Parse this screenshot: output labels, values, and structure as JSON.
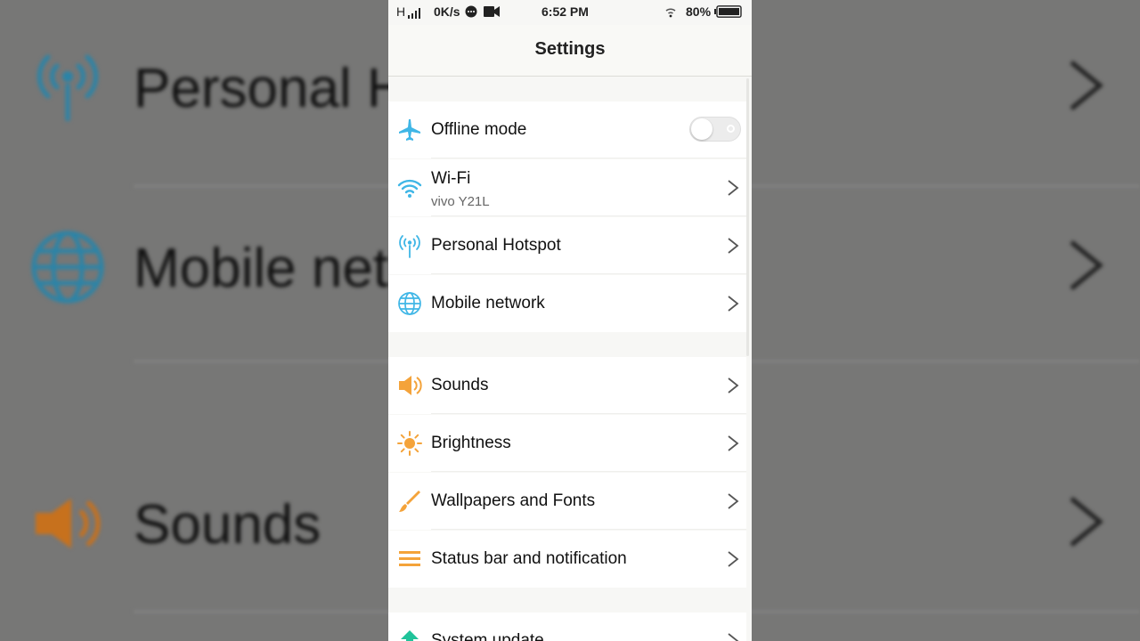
{
  "status_bar": {
    "signal": "H",
    "net_speed": "0K/s",
    "time": "6:52 PM",
    "battery": "80%"
  },
  "header": {
    "title": "Settings"
  },
  "background_zoom": {
    "items": [
      {
        "label": "Personal H",
        "icon": "hotspot-icon"
      },
      {
        "label": "Mobile net",
        "icon": "globe-icon"
      },
      {
        "label": "Sounds",
        "icon": "speaker-icon"
      }
    ]
  },
  "settings": {
    "group1": [
      {
        "label": "Offline mode",
        "icon": "airplane-icon",
        "control": "toggle",
        "toggle_on": false
      },
      {
        "label": "Wi-Fi",
        "sublabel": "vivo Y21L",
        "icon": "wifi-icon",
        "control": "chevron"
      },
      {
        "label": "Personal Hotspot",
        "icon": "hotspot-icon",
        "control": "chevron"
      },
      {
        "label": "Mobile network",
        "icon": "globe-icon",
        "control": "chevron"
      }
    ],
    "group2": [
      {
        "label": "Sounds",
        "icon": "speaker-icon",
        "control": "chevron"
      },
      {
        "label": "Brightness",
        "icon": "sun-icon",
        "control": "chevron"
      },
      {
        "label": "Wallpapers and Fonts",
        "icon": "brush-icon",
        "control": "chevron"
      },
      {
        "label": "Status bar and notification",
        "icon": "lines-icon",
        "control": "chevron"
      }
    ],
    "group3": [
      {
        "label": "System update",
        "icon": "arrow-up-icon",
        "control": "chevron"
      }
    ]
  },
  "colors": {
    "network_icon": "#3fb6e6",
    "display_icon": "#f4a33a",
    "system_icon": "#1fc39a"
  }
}
